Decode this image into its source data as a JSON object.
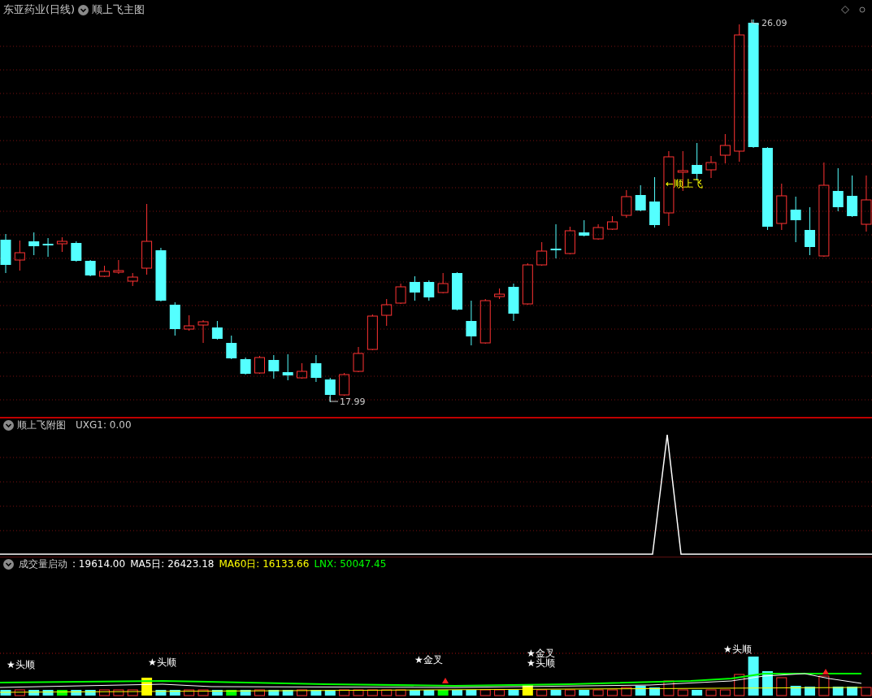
{
  "main_panel": {
    "stock_title": "东亚药业(日线)",
    "indicator": "顺上飞主图",
    "high_label": "26.09",
    "low_label": "17.99",
    "signal_label": "←顺上飞"
  },
  "sub_panel": {
    "indicator": "顺上飞附图",
    "reading": "UXG1: 0.00"
  },
  "volume_panel": {
    "indicator": "成交量启动",
    "readings": [
      {
        "text": ": 19614.00",
        "color": "#ffffff"
      },
      {
        "text": "MA5日: 26423.18",
        "color": "#ffffff"
      },
      {
        "text": "MA60日: 16133.66",
        "color": "#ffff00"
      },
      {
        "text": "LNX: 50047.45",
        "color": "#00ff00"
      }
    ],
    "signals": [
      {
        "text": "★头顺"
      },
      {
        "text": "★头顺"
      },
      {
        "text": "★金叉"
      },
      {
        "text": "★金叉"
      },
      {
        "text": "★头顺"
      },
      {
        "text": "★头顺"
      }
    ]
  }
}
